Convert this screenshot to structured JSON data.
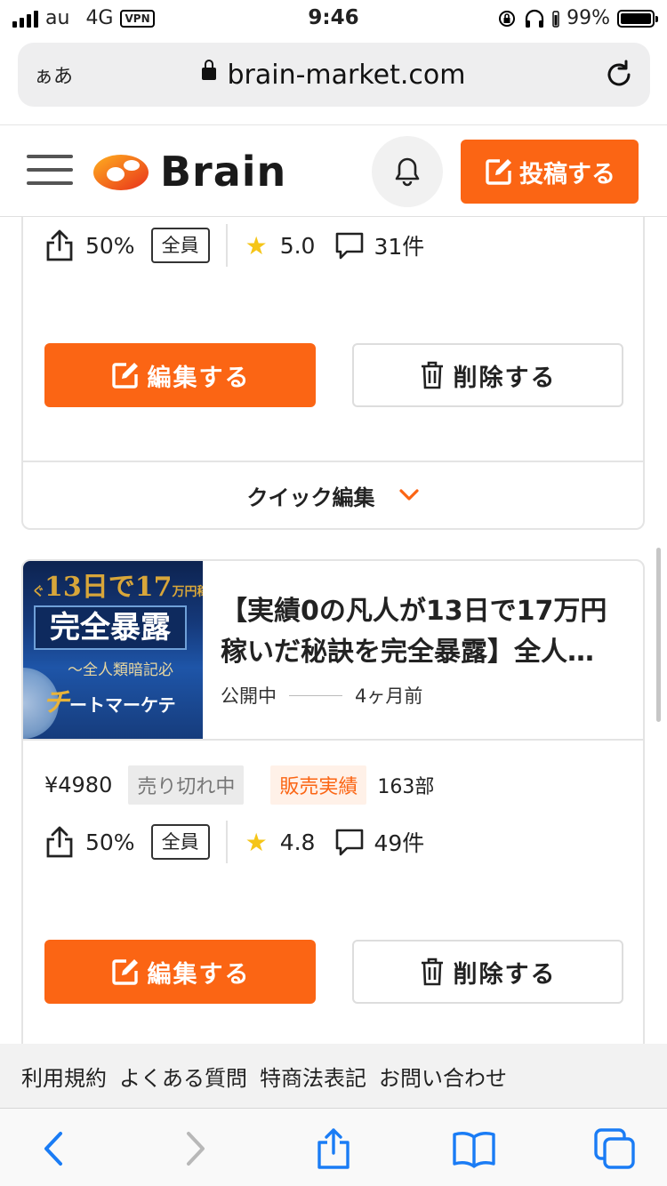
{
  "status_bar": {
    "carrier": "au",
    "network": "4G",
    "vpn": "VPN",
    "time": "9:46",
    "battery_pct": "99%",
    "battery_level": 0.99
  },
  "browser": {
    "aa_label": "ぁあ",
    "url": "brain-market.com"
  },
  "header": {
    "logo_text": "Brain",
    "post_label": "投稿する",
    "brand_color": "#fb6514"
  },
  "products": [
    {
      "affiliate_pct": "50%",
      "audience": "全員",
      "rating": "5.0",
      "comments": "31件",
      "edit_label": "編集する",
      "delete_label": "削除する",
      "quick_edit": "クイック編集"
    },
    {
      "title": "【実績0の凡人が13日で17万円稼いだ秘訣を完全暴露】全人…",
      "status": "公開中",
      "age": "4ヶ月前",
      "price": "¥4980",
      "soldout": "売り切れ中",
      "sales_label": "販売実績",
      "sales_count": "163部",
      "affiliate_pct": "50%",
      "audience": "全員",
      "rating": "4.8",
      "comments": "49件",
      "edit_label": "編集する",
      "delete_label": "削除する",
      "thumb": {
        "line1": "13日で17",
        "line1_small": "万円稼い",
        "line1_prefix": "ぐ",
        "line2": "完全暴露",
        "line3": "〜全人類暗記必",
        "line4": "チ",
        "line4_small": "ートマーケテ"
      }
    }
  ],
  "footer_links": [
    "利用規約",
    "よくある質問",
    "特商法表記",
    "お問い合わせ"
  ]
}
